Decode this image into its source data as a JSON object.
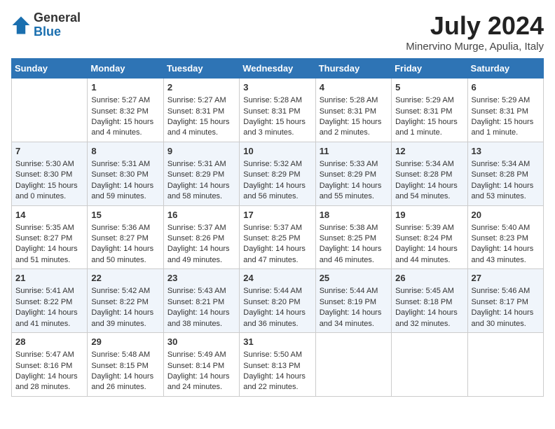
{
  "header": {
    "logo_general": "General",
    "logo_blue": "Blue",
    "month_year": "July 2024",
    "location": "Minervino Murge, Apulia, Italy"
  },
  "days_of_week": [
    "Sunday",
    "Monday",
    "Tuesday",
    "Wednesday",
    "Thursday",
    "Friday",
    "Saturday"
  ],
  "weeks": [
    [
      {
        "day": "",
        "sunrise": "",
        "sunset": "",
        "daylight": ""
      },
      {
        "day": "1",
        "sunrise": "Sunrise: 5:27 AM",
        "sunset": "Sunset: 8:32 PM",
        "daylight": "Daylight: 15 hours and 4 minutes."
      },
      {
        "day": "2",
        "sunrise": "Sunrise: 5:27 AM",
        "sunset": "Sunset: 8:31 PM",
        "daylight": "Daylight: 15 hours and 4 minutes."
      },
      {
        "day": "3",
        "sunrise": "Sunrise: 5:28 AM",
        "sunset": "Sunset: 8:31 PM",
        "daylight": "Daylight: 15 hours and 3 minutes."
      },
      {
        "day": "4",
        "sunrise": "Sunrise: 5:28 AM",
        "sunset": "Sunset: 8:31 PM",
        "daylight": "Daylight: 15 hours and 2 minutes."
      },
      {
        "day": "5",
        "sunrise": "Sunrise: 5:29 AM",
        "sunset": "Sunset: 8:31 PM",
        "daylight": "Daylight: 15 hours and 1 minute."
      },
      {
        "day": "6",
        "sunrise": "Sunrise: 5:29 AM",
        "sunset": "Sunset: 8:31 PM",
        "daylight": "Daylight: 15 hours and 1 minute."
      }
    ],
    [
      {
        "day": "7",
        "sunrise": "Sunrise: 5:30 AM",
        "sunset": "Sunset: 8:30 PM",
        "daylight": "Daylight: 15 hours and 0 minutes."
      },
      {
        "day": "8",
        "sunrise": "Sunrise: 5:31 AM",
        "sunset": "Sunset: 8:30 PM",
        "daylight": "Daylight: 14 hours and 59 minutes."
      },
      {
        "day": "9",
        "sunrise": "Sunrise: 5:31 AM",
        "sunset": "Sunset: 8:29 PM",
        "daylight": "Daylight: 14 hours and 58 minutes."
      },
      {
        "day": "10",
        "sunrise": "Sunrise: 5:32 AM",
        "sunset": "Sunset: 8:29 PM",
        "daylight": "Daylight: 14 hours and 56 minutes."
      },
      {
        "day": "11",
        "sunrise": "Sunrise: 5:33 AM",
        "sunset": "Sunset: 8:29 PM",
        "daylight": "Daylight: 14 hours and 55 minutes."
      },
      {
        "day": "12",
        "sunrise": "Sunrise: 5:34 AM",
        "sunset": "Sunset: 8:28 PM",
        "daylight": "Daylight: 14 hours and 54 minutes."
      },
      {
        "day": "13",
        "sunrise": "Sunrise: 5:34 AM",
        "sunset": "Sunset: 8:28 PM",
        "daylight": "Daylight: 14 hours and 53 minutes."
      }
    ],
    [
      {
        "day": "14",
        "sunrise": "Sunrise: 5:35 AM",
        "sunset": "Sunset: 8:27 PM",
        "daylight": "Daylight: 14 hours and 51 minutes."
      },
      {
        "day": "15",
        "sunrise": "Sunrise: 5:36 AM",
        "sunset": "Sunset: 8:27 PM",
        "daylight": "Daylight: 14 hours and 50 minutes."
      },
      {
        "day": "16",
        "sunrise": "Sunrise: 5:37 AM",
        "sunset": "Sunset: 8:26 PM",
        "daylight": "Daylight: 14 hours and 49 minutes."
      },
      {
        "day": "17",
        "sunrise": "Sunrise: 5:37 AM",
        "sunset": "Sunset: 8:25 PM",
        "daylight": "Daylight: 14 hours and 47 minutes."
      },
      {
        "day": "18",
        "sunrise": "Sunrise: 5:38 AM",
        "sunset": "Sunset: 8:25 PM",
        "daylight": "Daylight: 14 hours and 46 minutes."
      },
      {
        "day": "19",
        "sunrise": "Sunrise: 5:39 AM",
        "sunset": "Sunset: 8:24 PM",
        "daylight": "Daylight: 14 hours and 44 minutes."
      },
      {
        "day": "20",
        "sunrise": "Sunrise: 5:40 AM",
        "sunset": "Sunset: 8:23 PM",
        "daylight": "Daylight: 14 hours and 43 minutes."
      }
    ],
    [
      {
        "day": "21",
        "sunrise": "Sunrise: 5:41 AM",
        "sunset": "Sunset: 8:22 PM",
        "daylight": "Daylight: 14 hours and 41 minutes."
      },
      {
        "day": "22",
        "sunrise": "Sunrise: 5:42 AM",
        "sunset": "Sunset: 8:22 PM",
        "daylight": "Daylight: 14 hours and 39 minutes."
      },
      {
        "day": "23",
        "sunrise": "Sunrise: 5:43 AM",
        "sunset": "Sunset: 8:21 PM",
        "daylight": "Daylight: 14 hours and 38 minutes."
      },
      {
        "day": "24",
        "sunrise": "Sunrise: 5:44 AM",
        "sunset": "Sunset: 8:20 PM",
        "daylight": "Daylight: 14 hours and 36 minutes."
      },
      {
        "day": "25",
        "sunrise": "Sunrise: 5:44 AM",
        "sunset": "Sunset: 8:19 PM",
        "daylight": "Daylight: 14 hours and 34 minutes."
      },
      {
        "day": "26",
        "sunrise": "Sunrise: 5:45 AM",
        "sunset": "Sunset: 8:18 PM",
        "daylight": "Daylight: 14 hours and 32 minutes."
      },
      {
        "day": "27",
        "sunrise": "Sunrise: 5:46 AM",
        "sunset": "Sunset: 8:17 PM",
        "daylight": "Daylight: 14 hours and 30 minutes."
      }
    ],
    [
      {
        "day": "28",
        "sunrise": "Sunrise: 5:47 AM",
        "sunset": "Sunset: 8:16 PM",
        "daylight": "Daylight: 14 hours and 28 minutes."
      },
      {
        "day": "29",
        "sunrise": "Sunrise: 5:48 AM",
        "sunset": "Sunset: 8:15 PM",
        "daylight": "Daylight: 14 hours and 26 minutes."
      },
      {
        "day": "30",
        "sunrise": "Sunrise: 5:49 AM",
        "sunset": "Sunset: 8:14 PM",
        "daylight": "Daylight: 14 hours and 24 minutes."
      },
      {
        "day": "31",
        "sunrise": "Sunrise: 5:50 AM",
        "sunset": "Sunset: 8:13 PM",
        "daylight": "Daylight: 14 hours and 22 minutes."
      },
      {
        "day": "",
        "sunrise": "",
        "sunset": "",
        "daylight": ""
      },
      {
        "day": "",
        "sunrise": "",
        "sunset": "",
        "daylight": ""
      },
      {
        "day": "",
        "sunrise": "",
        "sunset": "",
        "daylight": ""
      }
    ]
  ]
}
